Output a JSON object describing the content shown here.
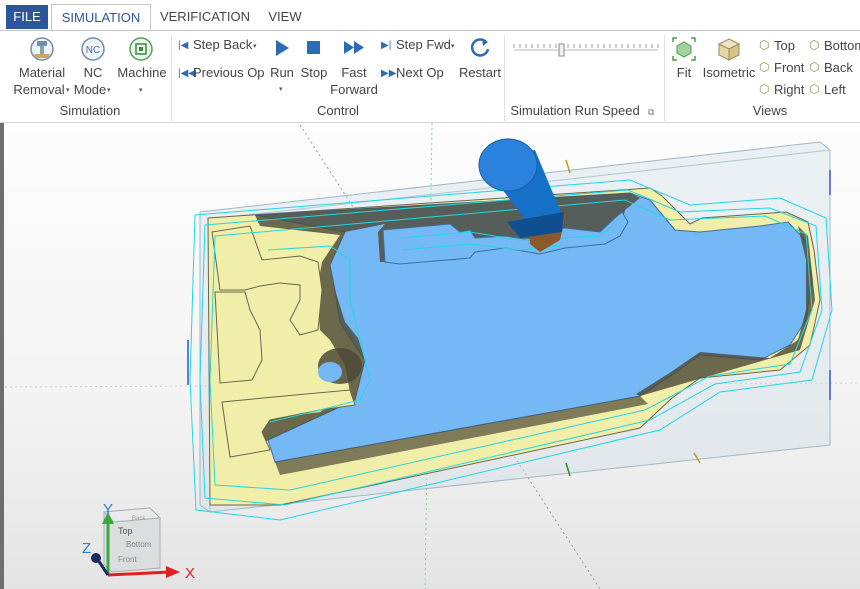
{
  "tabs": {
    "file": "FILE",
    "simulation": "SIMULATION",
    "verification": "VERIFICATION",
    "view": "VIEW"
  },
  "groups": {
    "simulation": {
      "label": "Simulation",
      "material_removal": [
        "Material",
        "Removal"
      ],
      "nc_mode": [
        "NC",
        "Mode"
      ],
      "nc_icon_text": "NC",
      "machine": "Machine"
    },
    "control": {
      "label": "Control",
      "step_back": "Step Back",
      "previous_op": "Previous Op",
      "run": "Run",
      "stop": "Stop",
      "fast_forward": [
        "Fast",
        "Forward"
      ],
      "step_fwd": "Step Fwd",
      "next_op": "Next Op",
      "restart": "Restart"
    },
    "speed": {
      "label": "Simulation Run Speed",
      "value": 0.33
    },
    "views": {
      "label": "Views",
      "fit": "Fit",
      "isometric": "Isometric",
      "top": "Top",
      "front": "Front",
      "right": "Right",
      "bottom": "Bottom",
      "back": "Back",
      "left": "Left"
    }
  },
  "viewcube": {
    "top": "Top",
    "front": "Front",
    "bottom": "Bottom",
    "back": "Back"
  },
  "axes": {
    "x": "X",
    "y": "Y",
    "z": "Z"
  },
  "colors": {
    "ribbon_accent": "#2b579a",
    "part_surface": "#f1eeaa",
    "pocket_floor": "#74b8f5",
    "wall_shadow": "#4e4a36",
    "toolpath": "#20d8e0",
    "tool_holder": "#1670c8",
    "tool_cutter": "#8a5a2c",
    "stock_box": "#b5d0e0"
  }
}
